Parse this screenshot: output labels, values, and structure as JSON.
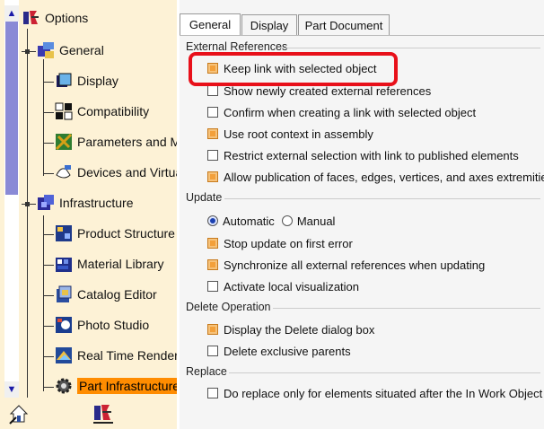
{
  "tree": {
    "root": {
      "label": "Options",
      "icon": "options-icon"
    },
    "items": [
      {
        "label": "General",
        "icon": "general-icon"
      },
      {
        "label": "Display",
        "icon": "display-icon"
      },
      {
        "label": "Compatibility",
        "icon": "compatibility-icon"
      },
      {
        "label": "Parameters and M",
        "icon": "parameters-icon"
      },
      {
        "label": "Devices and Virtua",
        "icon": "devices-icon"
      },
      {
        "label": "Infrastructure",
        "icon": "infrastructure-icon"
      },
      {
        "label": "Product Structure",
        "icon": "product-structure-icon"
      },
      {
        "label": "Material Library",
        "icon": "material-library-icon"
      },
      {
        "label": "Catalog Editor",
        "icon": "catalog-editor-icon"
      },
      {
        "label": "Photo Studio",
        "icon": "photo-studio-icon"
      },
      {
        "label": "Real Time Renderi",
        "icon": "real-time-rendering-icon"
      },
      {
        "label": "Part Infrastructure",
        "icon": "gear-icon",
        "selected": true
      }
    ]
  },
  "tabs": [
    {
      "label": "General",
      "active": true
    },
    {
      "label": "Display",
      "active": false
    },
    {
      "label": "Part Document",
      "active": false
    }
  ],
  "sections": {
    "external": {
      "title": "External References",
      "options": [
        {
          "label": "Keep link with selected object",
          "checked": true
        },
        {
          "label": "Show newly created external references",
          "checked": false
        },
        {
          "label": "Confirm when creating a link with selected object",
          "checked": false
        },
        {
          "label": "Use root context in assembly",
          "checked": true
        },
        {
          "label": "Restrict external selection with link to published elements",
          "checked": false
        },
        {
          "label": "Allow publication of faces, edges, vertices, and axes extremities",
          "checked": true
        }
      ]
    },
    "update": {
      "title": "Update",
      "radio": [
        {
          "label": "Automatic",
          "selected": true
        },
        {
          "label": "Manual",
          "selected": false
        }
      ],
      "options": [
        {
          "label": "Stop update on first error",
          "checked": true
        },
        {
          "label": "Synchronize all external references when updating",
          "checked": true
        },
        {
          "label": "Activate local visualization",
          "checked": false
        }
      ]
    },
    "delete": {
      "title": "Delete Operation",
      "options": [
        {
          "label": "Display the Delete dialog box",
          "checked": true
        },
        {
          "label": "Delete exclusive parents",
          "checked": false
        }
      ]
    },
    "replace": {
      "title": "Replace",
      "options": [
        {
          "label": "Do replace only for elements situated after the In Work Object",
          "checked": false
        }
      ]
    }
  },
  "colors": {
    "highlight": "#e8101a",
    "selection": "#ff8c00",
    "checked_fill": "#f3a03a"
  }
}
